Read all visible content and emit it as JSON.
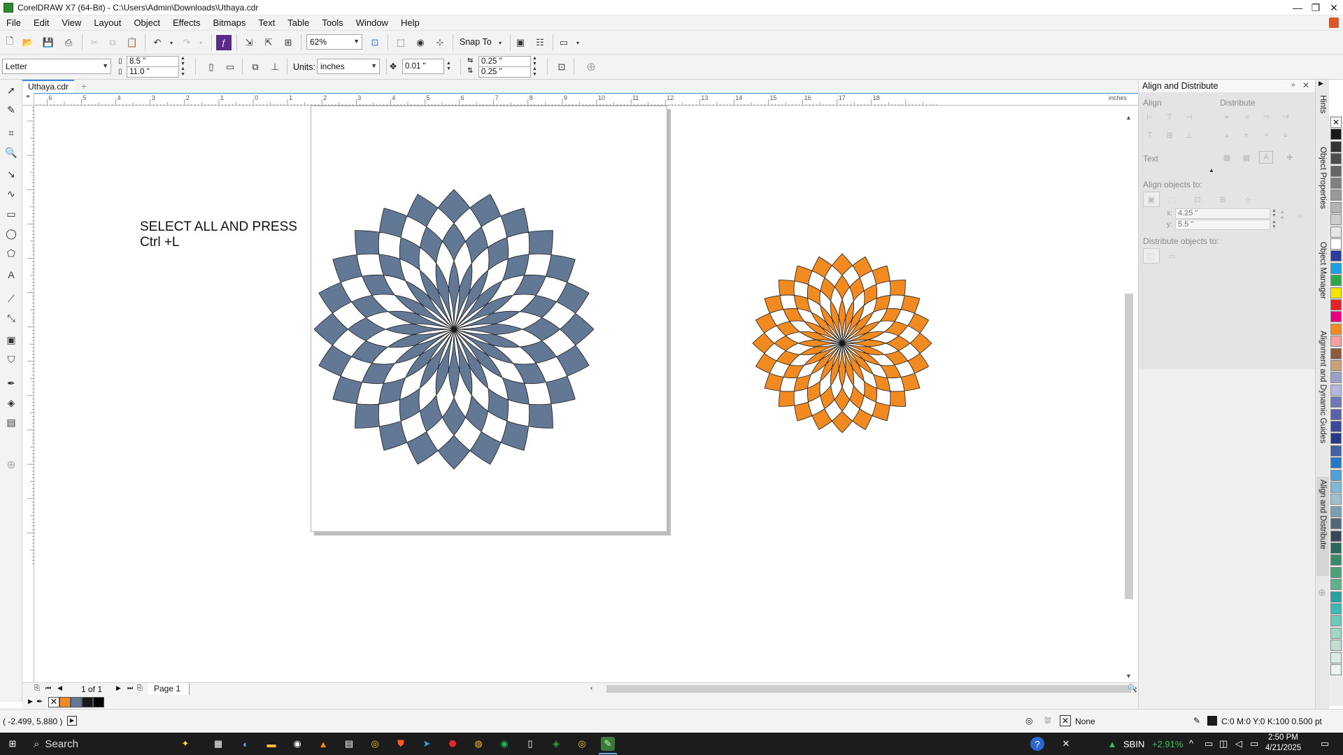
{
  "window": {
    "title": "CorelDRAW X7 (64-Bit) - C:\\Users\\Admin\\Downloads\\Uthaya.cdr",
    "minimize": "—",
    "maximize": "❐",
    "close": "✕"
  },
  "menu": [
    {
      "label": "File"
    },
    {
      "label": "Edit"
    },
    {
      "label": "View"
    },
    {
      "label": "Layout"
    },
    {
      "label": "Object"
    },
    {
      "label": "Effects"
    },
    {
      "label": "Bitmaps"
    },
    {
      "label": "Text"
    },
    {
      "label": "Table"
    },
    {
      "label": "Tools"
    },
    {
      "label": "Window"
    },
    {
      "label": "Help"
    }
  ],
  "standard_toolbar": {
    "zoom": "62%",
    "snap_to": "Snap To"
  },
  "property_bar": {
    "page_size": "Letter",
    "width": "8.5 \"",
    "height": "11.0 \"",
    "units_label": "Units:",
    "units": "inches",
    "nudge": "0.01 \"",
    "dup_x": "0.25 \"",
    "dup_y": "0.25 \""
  },
  "document_tab": "Uthaya.cdr",
  "ruler": {
    "unit": "inches",
    "h_ticks": [
      "6",
      "5",
      "4",
      "3",
      "2",
      "1",
      "0",
      "1",
      "2",
      "3",
      "4",
      "5",
      "6",
      "7",
      "8",
      "9",
      "10",
      "11",
      "12",
      "13",
      "14",
      "15",
      "16",
      "17",
      "18"
    ],
    "v_ticks": [
      "11",
      "10",
      "9",
      "8",
      "7",
      "6",
      "5",
      "4",
      "3",
      "2",
      "1",
      "0",
      "1",
      "2"
    ]
  },
  "canvas_text": {
    "line1": "SELECT ALL AND PRESS",
    "line2": "Ctrl +L"
  },
  "shapes": {
    "left_fill": "#627894",
    "right_fill": "#F28A22",
    "outline": "#1a1a1a"
  },
  "page_nav": {
    "count": "1 of 1",
    "page_tab": "Page 1"
  },
  "document_palette": [
    "#F28A22",
    "#627894",
    "#1a1a1a",
    "#000000"
  ],
  "status": {
    "cursor": "( -2.499, 5.880 )",
    "fill": "None",
    "outline": "C:0 M:0 Y:0 K:100  0.500 pt"
  },
  "docker": {
    "title": "Align and Distribute",
    "align": "Align",
    "distribute": "Distribute",
    "text": "Text",
    "align_to": "Align objects to:",
    "x_label": "x:",
    "x_value": "4.25 \"",
    "y_label": "y:",
    "y_value": "5.5 \"",
    "distribute_to": "Distribute objects to:"
  },
  "side_tabs": [
    {
      "label": "Hints"
    },
    {
      "label": "Object Properties"
    },
    {
      "label": "Object Manager"
    },
    {
      "label": "Alignment and Dynamic Guides"
    },
    {
      "label": "Align and Distribute"
    }
  ],
  "color_palette": [
    "#ffffff",
    "#1a1a1a",
    "#333333",
    "#4d4d4d",
    "#666666",
    "#808080",
    "#999999",
    "#b3b3b3",
    "#cccccc",
    "#e6e6e6",
    "#ffffff",
    "#2a3c9c",
    "#1ea0e0",
    "#2ea84a",
    "#f5e400",
    "#e8202a",
    "#e8007d",
    "#f28a22",
    "#f4a0a0",
    "#8c5a3c",
    "#c8a07a",
    "#9aa0c8",
    "#b4b8e0",
    "#7078b8",
    "#5860a8",
    "#3c4898",
    "#283a88",
    "#4060a8",
    "#2878c8",
    "#50a0d8",
    "#80b8d8",
    "#a0c0d0",
    "#78a0b0",
    "#506878",
    "#384858",
    "#2a6a5a",
    "#3a8a6a",
    "#4ca07a",
    "#60b08a",
    "#2aa0a0",
    "#40b8b0",
    "#70c8b8",
    "#a0d8c8",
    "#c0e0d0",
    "#d8ece0",
    "#e8f4ec"
  ],
  "taskbar": {
    "search": "Search",
    "stock_name": "SBIN",
    "stock_change": "+2.91%",
    "time": "2:50 PM",
    "date": "4/21/2025"
  }
}
